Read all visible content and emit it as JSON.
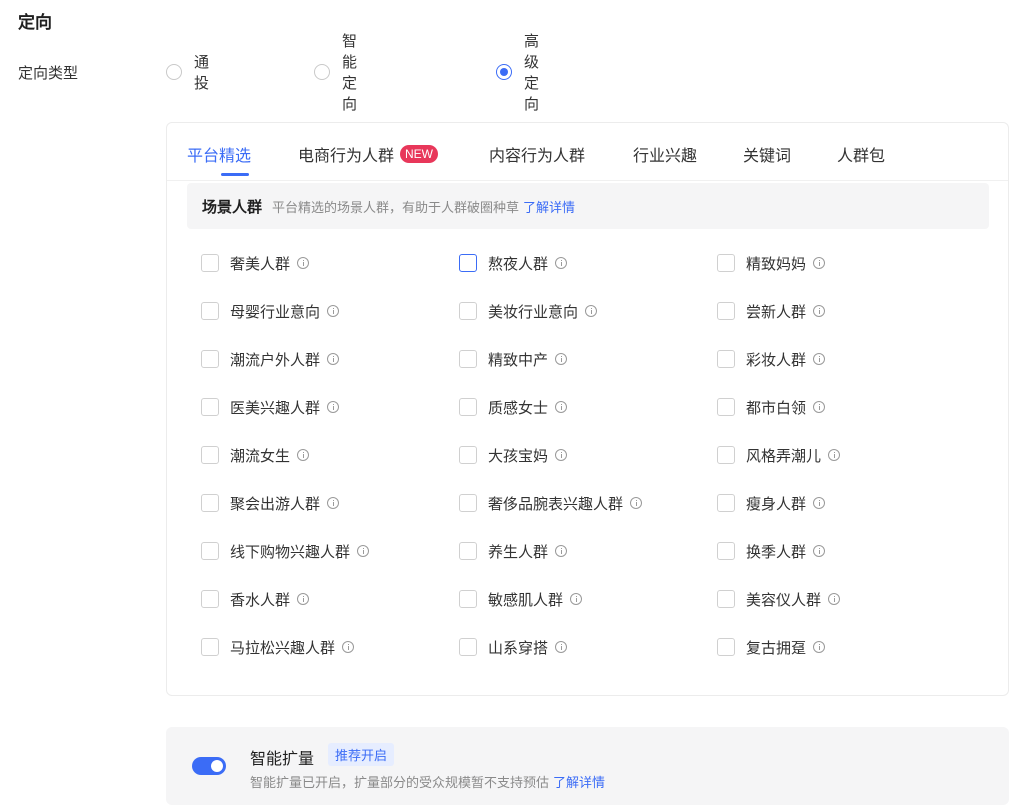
{
  "section": {
    "title": "定向"
  },
  "targeting_type": {
    "label": "定向类型",
    "options": [
      {
        "label": "通投",
        "checked": false
      },
      {
        "label": "智能定向",
        "checked": false
      },
      {
        "label": "高级定向",
        "checked": true
      }
    ]
  },
  "tabs": [
    {
      "label": "平台精选",
      "active": true
    },
    {
      "label": "电商行为人群",
      "badge": "NEW"
    },
    {
      "label": "内容行为人群"
    },
    {
      "label": "行业兴趣"
    },
    {
      "label": "关键词"
    },
    {
      "label": "人群包"
    }
  ],
  "scene": {
    "title": "场景人群",
    "description": "平台精选的场景人群，有助于人群破圈种草",
    "link": "了解详情"
  },
  "audiences": [
    [
      "奢美人群",
      "熬夜人群",
      "精致妈妈"
    ],
    [
      "母婴行业意向",
      "美妆行业意向",
      "尝新人群"
    ],
    [
      "潮流户外人群",
      "精致中产",
      "彩妆人群"
    ],
    [
      "医美兴趣人群",
      "质感女士",
      "都市白领"
    ],
    [
      "潮流女生",
      "大孩宝妈",
      "风格弄潮儿"
    ],
    [
      "聚会出游人群",
      "奢侈品腕表兴趣人群",
      "瘦身人群"
    ],
    [
      "线下购物兴趣人群",
      "养生人群",
      "换季人群"
    ],
    [
      "香水人群",
      "敏感肌人群",
      "美容仪人群"
    ],
    [
      "马拉松兴趣人群",
      "山系穿搭",
      "复古拥趸"
    ]
  ],
  "smart_expand": {
    "title": "智能扩量",
    "tag": "推荐开启",
    "description": "智能扩量已开启，扩量部分的受众规模暂不支持预估",
    "link": "了解详情",
    "enabled": true
  },
  "colors": {
    "accent": "#3b6cf6",
    "badge": "#e8375a"
  }
}
